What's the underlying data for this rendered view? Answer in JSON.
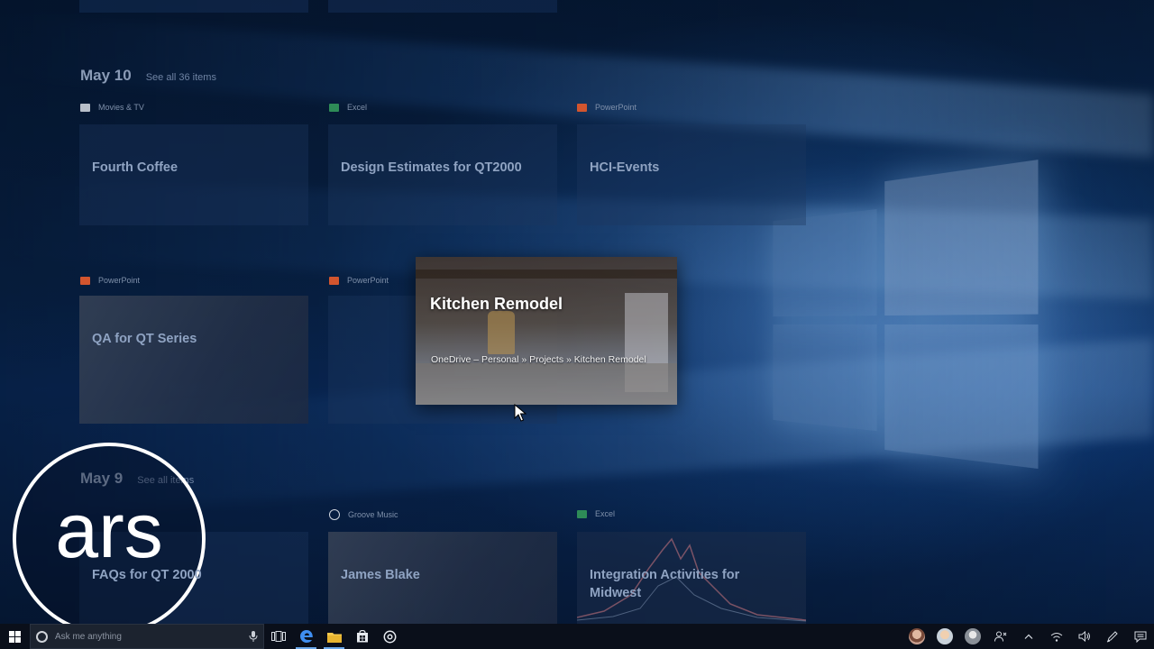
{
  "timeline": {
    "groups": [
      {
        "date": "May 10",
        "see_all": "See all 36 items",
        "activities": [
          {
            "app": "Movies & TV",
            "title": "Fourth Coffee",
            "app_color": "#b8bfc9"
          },
          {
            "app": "Excel",
            "title": "Design Estimates for QT2000",
            "app_color": "#2e8b57"
          },
          {
            "app": "PowerPoint",
            "title": "HCI-Events",
            "app_color": "#d2552e"
          },
          {
            "app": "PowerPoint",
            "title": "QA for QT Series",
            "app_color": "#d2552e"
          },
          {
            "app": "PowerPoint",
            "title": "",
            "app_color": "#d2552e"
          }
        ]
      },
      {
        "date": "May 9",
        "see_all": "See all items",
        "activities": [
          {
            "app": "",
            "title": "FAQs for QT 2000",
            "app_color": "#2b66c4"
          },
          {
            "app": "Groove Music",
            "title": "James Blake",
            "app_color": "#cfd5de"
          },
          {
            "app": "Excel",
            "title": "Integration Activities for Midwest",
            "app_color": "#2e8b57"
          }
        ]
      }
    ],
    "focused": {
      "title": "Kitchen Remodel",
      "path": "OneDrive – Personal » Projects » Kitchen Remodel"
    }
  },
  "logo": {
    "text": "ars"
  },
  "taskbar": {
    "search_placeholder": "Ask me anything",
    "pinned": [
      "task-view-icon",
      "edge-icon",
      "file-explorer-icon",
      "store-icon",
      "groove-icon"
    ],
    "tray_icons": [
      "people-avatar-1",
      "people-avatar-2",
      "people-avatar-3",
      "people-icon",
      "chevron-up-icon",
      "network-icon",
      "volume-icon",
      "pen-icon",
      "notification-icon"
    ],
    "accent_color": "#6aa8ec"
  }
}
